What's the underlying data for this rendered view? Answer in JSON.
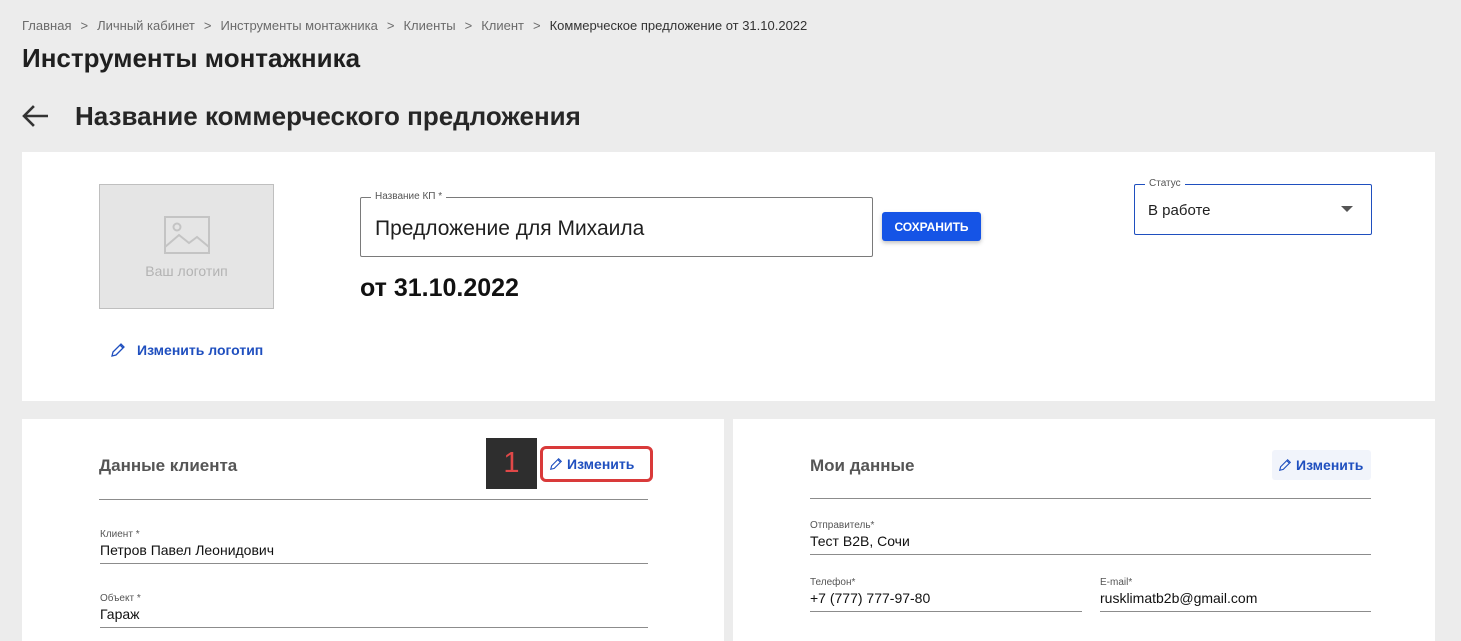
{
  "breadcrumb": {
    "items": [
      "Главная",
      "Личный кабинет",
      "Инструменты монтажника",
      "Клиенты",
      "Клиент",
      "Коммерческое предложение от 31.10.2022"
    ],
    "separator": ">"
  },
  "page_title": "Инструменты монтажника",
  "offer_heading": "Название коммерческого предложения",
  "top_card": {
    "logo_placeholder": "Ваш логотип",
    "change_logo_label": "Изменить логотип",
    "kp_name_label": "Название КП *",
    "kp_name_value": "Предложение для Михаила",
    "save_label": "СОХРАНИТЬ",
    "kp_date": "от 31.10.2022",
    "status_label": "Статус",
    "status_value": "В работе"
  },
  "client_card": {
    "title": "Данные клиента",
    "edit_label": "Изменить",
    "step_badge": "1",
    "fields": [
      {
        "label": "Клиент *",
        "value": "Петров Павел Леонидович"
      },
      {
        "label": "Объект *",
        "value": "Гараж"
      }
    ]
  },
  "my_card": {
    "title": "Мои данные",
    "edit_label": "Изменить",
    "fields": [
      {
        "label": "Отправитель*",
        "value": "Тест B2B, Сочи"
      },
      {
        "label": "Телефон*",
        "value": "+7 (777) 777-97-80"
      },
      {
        "label": "E-mail*",
        "value": "rusklimatb2b@gmail.com"
      }
    ]
  },
  "colors": {
    "accent": "#1554e6",
    "link": "#1f4fbf",
    "highlight": "#d93a3a",
    "background": "#ececec"
  },
  "icons": [
    "back-arrow-icon",
    "image-placeholder-icon",
    "pencil-icon",
    "chevron-down-icon"
  ]
}
